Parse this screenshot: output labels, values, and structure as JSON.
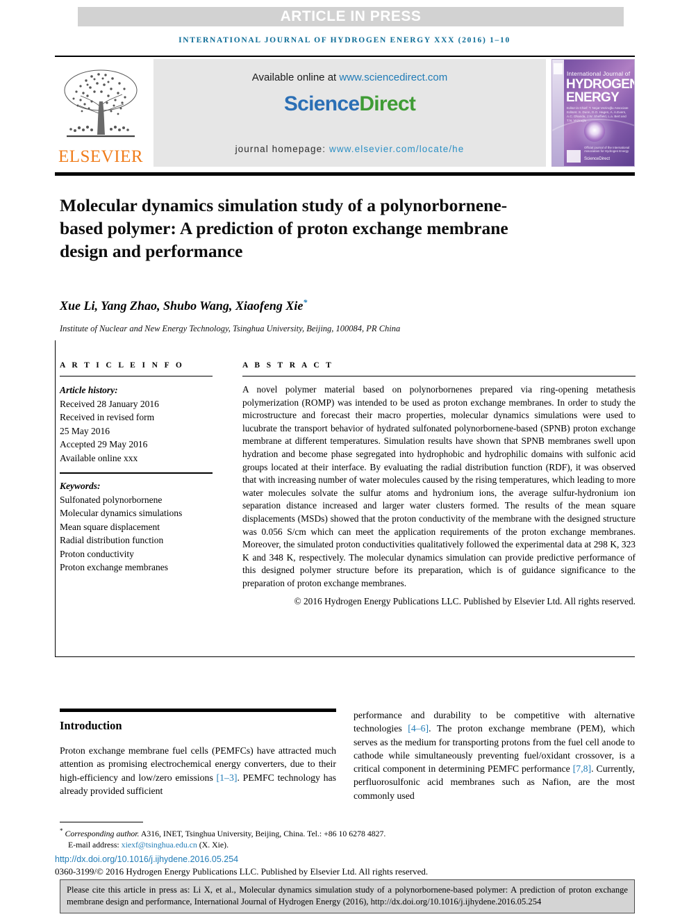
{
  "banner": {
    "text": "ARTICLE IN PRESS"
  },
  "running_head": "INTERNATIONAL JOURNAL OF HYDROGEN ENERGY XXX (2016) 1–10",
  "masthead": {
    "publisher": "ELSEVIER",
    "available_prefix": "Available online at ",
    "available_url": "www.sciencedirect.com",
    "logo_part1": "Science",
    "logo_part2": "Direct",
    "homepage_prefix": "journal homepage: ",
    "homepage_url": "www.elsevier.com/locate/he",
    "cover": {
      "line1": "International Journal of",
      "line2": "HYDROGEN",
      "line3": "ENERGY",
      "editors": "Editor-in-Chief: T. Nejat Veziroğlu   Associate Editors: S. Dunn, D.O. Hagen, A. A.Evers, A.C. Dhanda, J.W. Sheffield, L.a. Bert and T.N. Veziroğlu",
      "tagline": "Official journal of the International Association for Hydrogen Energy",
      "sciencedirect": "ScienceDirect"
    }
  },
  "article": {
    "title": "Molecular dynamics simulation study of a polynorbornene-based polymer: A prediction of proton exchange membrane design and performance",
    "authors": "Xue Li, Yang Zhao, Shubo Wang, Xiaofeng Xie",
    "corresponding_marker": "*",
    "affiliation": "Institute of Nuclear and New Energy Technology, Tsinghua University, Beijing, 100084, PR China"
  },
  "article_info": {
    "label": "A R T I C L E  I N F O",
    "history_label": "Article history:",
    "history": [
      "Received 28 January 2016",
      "Received in revised form",
      "25 May 2016",
      "Accepted 29 May 2016",
      "Available online xxx"
    ],
    "keywords_label": "Keywords:",
    "keywords": [
      "Sulfonated polynorbornene",
      "Molecular dynamics simulations",
      "Mean square displacement",
      "Radial distribution function",
      "Proton conductivity",
      "Proton exchange membranes"
    ]
  },
  "abstract": {
    "label": "A B S T R A C T",
    "body": "A novel polymer material based on polynorbornenes prepared via ring-opening metathesis polymerization (ROMP) was intended to be used as proton exchange membranes. In order to study the microstructure and forecast their macro properties, molecular dynamics simulations were used to lucubrate the transport behavior of hydrated sulfonated polynorbornene-based (SPNB) proton exchange membrane at different temperatures. Simulation results have shown that SPNB membranes swell upon hydration and become phase segregated into hydrophobic and hydrophilic domains with sulfonic acid groups located at their interface. By evaluating the radial distribution function (RDF), it was observed that with increasing number of water molecules caused by the rising temperatures, which leading to more water molecules solvate the sulfur atoms and hydronium ions, the average sulfur-hydronium ion separation distance increased and larger water clusters formed. The results of the mean square displacements (MSDs) showed that the proton conductivity of the membrane with the designed structure was 0.056 S/cm which can meet the application requirements of the proton exchange membranes. Moreover, the simulated proton conductivities qualitatively followed the experimental data at 298 K, 323 K and 348 K, respectively. The molecular dynamics simulation can provide predictive performance of this designed polymer structure before its preparation, which is of guidance significance to the preparation of proton exchange membranes.",
    "copyright": "© 2016 Hydrogen Energy Publications LLC. Published by Elsevier Ltd. All rights reserved."
  },
  "introduction": {
    "heading": "Introduction",
    "left_part1": "Proton exchange membrane fuel cells (PEMFCs) have attracted much attention as promising electrochemical energy converters, due to their high-efficiency and low/zero emissions ",
    "left_cite1": "[1–3]",
    "left_part2": ". PEMFC technology has already provided sufficient",
    "right_part1": "performance and durability to be competitive with alternative technologies ",
    "right_cite1": "[4–6]",
    "right_part2": ". The proton exchange membrane (PEM), which serves as the medium for transporting protons from the fuel cell anode to cathode while simultaneously preventing fuel/oxidant crossover, is a critical component in determining PEMFC performance ",
    "right_cite2": "[7,8]",
    "right_part3": ". Currently, perfluorosulfonic acid membranes such as Nafion, are the most commonly used"
  },
  "footnote": {
    "marker": "*",
    "corresponding_italic": "Corresponding author.",
    "corresponding_rest": " A316, INET, Tsinghua University, Beijing, China. Tel.: +86 10 6278 4827.",
    "email_label": "E-mail address: ",
    "email": "xiexf@tsinghua.edu.cn",
    "email_suffix": " (X. Xie).",
    "doi": "http://dx.doi.org/10.1016/j.ijhydene.2016.05.254",
    "issn": "0360-3199/© 2016 Hydrogen Energy Publications LLC. Published by Elsevier Ltd. All rights reserved."
  },
  "cite_box": {
    "text": "Please cite this article in press as: Li X, et al., Molecular dynamics simulation study of a polynorbornene-based polymer: A prediction of proton exchange membrane design and performance, International Journal of Hydrogen Energy (2016), http://dx.doi.org/10.1016/j.ijhydene.2016.05.254"
  },
  "colors": {
    "link": "#1f7bb6",
    "running_head": "#0b6b96",
    "elsevier_orange": "#f07c1a",
    "sd_green": "#3f9c35",
    "banner_gray": "#d2d2d2"
  }
}
